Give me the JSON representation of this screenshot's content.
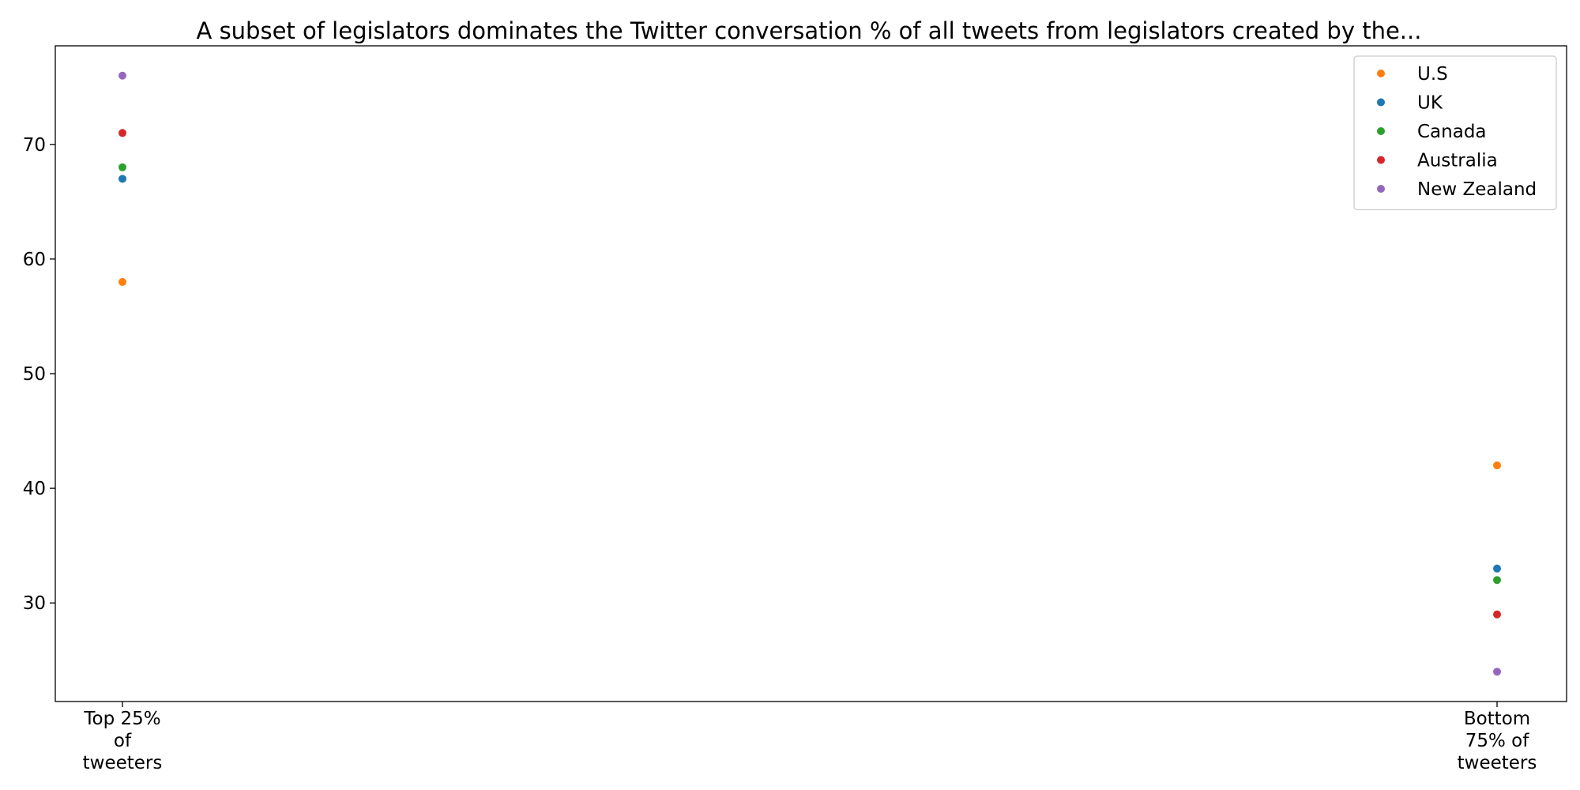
{
  "chart_data": {
    "type": "scatter",
    "title": "A subset of legislators dominates the Twitter conversation % of all tweets from legislators created by the...",
    "xlabel": "",
    "ylabel": "",
    "categories": [
      [
        "Top 25%",
        "of",
        "tweeters"
      ],
      [
        "Bottom",
        "75% of",
        "tweeters"
      ]
    ],
    "ylim": [
      21.4,
      78.6
    ],
    "yticks": [
      30,
      40,
      50,
      60,
      70
    ],
    "grid": false,
    "legend_position": "top-right",
    "series": [
      {
        "name": "U.S",
        "color": "#ff7f0e",
        "values": [
          58,
          42
        ]
      },
      {
        "name": "UK",
        "color": "#1f77b4",
        "values": [
          67,
          33
        ]
      },
      {
        "name": "Canada",
        "color": "#2ca02c",
        "values": [
          68,
          32
        ]
      },
      {
        "name": "Australia",
        "color": "#d62728",
        "values": [
          71,
          29
        ]
      },
      {
        "name": "New Zealand",
        "color": "#9467bd",
        "values": [
          76,
          24
        ]
      }
    ]
  }
}
